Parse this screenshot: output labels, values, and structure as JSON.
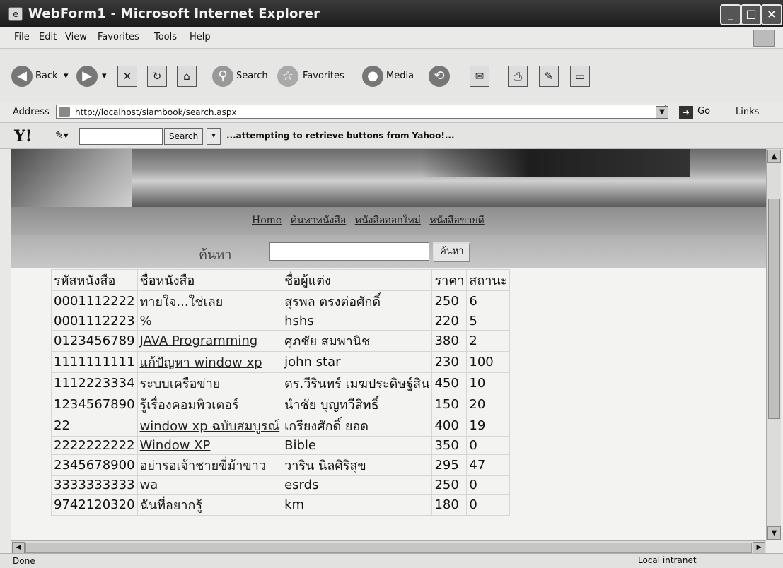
{
  "window": {
    "title": "WebForm1 - Microsoft Internet Explorer"
  },
  "menu": [
    "File",
    "Edit",
    "View",
    "Favorites",
    "Tools",
    "Help"
  ],
  "toolbar": {
    "back_label": "Back",
    "search_label": "Search",
    "favorites_label": "Favorites",
    "media_label": "Media"
  },
  "address": {
    "label": "Address",
    "url": "http://localhost/siambook/search.aspx",
    "go_label": "Go",
    "links_label": "Links"
  },
  "yahoo": {
    "search_label": "Search",
    "status": "...attempting to retrieve buttons from Yahoo!..."
  },
  "page": {
    "nav": [
      "Home",
      "ค้นหาหนังสือ",
      "หนังสือออกใหม่",
      "หนังสือขายดี"
    ],
    "search_label": "ค้นหา",
    "search_button": "ค้นหา",
    "table": {
      "headers": [
        "รหัสหนังสือ",
        "ชื่อหนังสือ",
        "ชื่อผู้แต่ง",
        "ราคา",
        "สถานะ"
      ],
      "rows": [
        [
          "0001112222",
          "ทายใจ...ใช่เลย",
          "สุรพล ตรงต่อศักดิ์",
          "250",
          "6"
        ],
        [
          "0001112223",
          "%",
          "hshs",
          "220",
          "5"
        ],
        [
          "0123456789",
          "JAVA Programming",
          "ศุภชัย สมพานิช",
          "380",
          "2"
        ],
        [
          "1111111111",
          "แก้ปัญหา window xp",
          "john star",
          "230",
          "100"
        ],
        [
          "1112223334",
          "ระบบเครือข่าย",
          "ดร.วีรินทร์ เมฆประดิษฐ์สิน",
          "450",
          "10"
        ],
        [
          "1234567890",
          "รู้เรื่องคอมพิวเตอร์",
          "นำชัย บุญทวีสิทธิ์",
          "150",
          "20"
        ],
        [
          "22",
          "window xp ฉบับสมบูรณ์",
          "เกรียงศักดิ์ ยอด",
          "400",
          "19"
        ],
        [
          "2222222222",
          "Window XP",
          "Bible",
          "350",
          "0"
        ],
        [
          "2345678900",
          "อย่ารอเจ้าชายขี่ม้าขาว",
          "วาริน นิลศิริสุข",
          "295",
          "47"
        ],
        [
          "3333333333",
          "wa",
          "esrds",
          "250",
          "0"
        ],
        [
          "9742120320",
          "ฉันที่อยากรู้",
          "km",
          "180",
          "0"
        ]
      ]
    }
  },
  "status": {
    "left": "Done",
    "zone": "Local intranet"
  }
}
